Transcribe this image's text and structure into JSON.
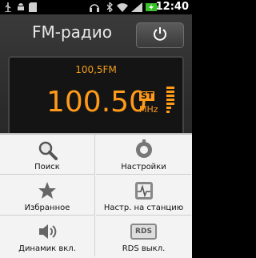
{
  "status_bar": {
    "time": "12:40",
    "icons": [
      "usb-icon",
      "android-icon",
      "sd-card-icon",
      "headset-icon",
      "bluetooth-icon",
      "wifi-icon",
      "signal-icon",
      "battery-charging-icon"
    ]
  },
  "header": {
    "title": "FM-радио",
    "power_icon": "power-icon"
  },
  "display": {
    "station": "100,5FM",
    "frequency": "100.50",
    "stereo": "ST",
    "unit": "MHz"
  },
  "menu": {
    "items": [
      {
        "label": "Поиск",
        "icon": "search-icon"
      },
      {
        "label": "Настройки",
        "icon": "settings-icon"
      },
      {
        "label": "Избранное",
        "icon": "star-icon"
      },
      {
        "label": "Настр. на станцию",
        "icon": "tune-station-icon"
      },
      {
        "label": "Динамик вкл.",
        "icon": "speaker-icon"
      },
      {
        "label": "RDS выкл.",
        "icon": "rds-icon",
        "icon_text": "RDS"
      }
    ]
  },
  "colors": {
    "accent": "#ff9a1a",
    "display_bg": "#141414",
    "menu_bg": "#f3f3f3"
  }
}
